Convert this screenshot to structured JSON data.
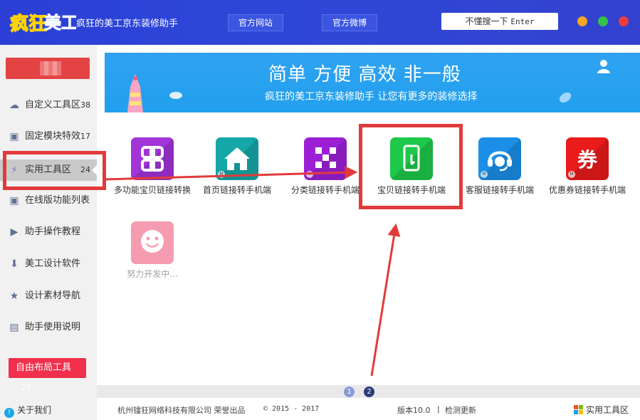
{
  "app": {
    "logo_text": "疯狂美工",
    "title": "疯狂的美工京东装修助手",
    "header_buttons": [
      "官方网站",
      "官方微博"
    ],
    "search_hint": "不懂搜一下",
    "search_key": "Enter"
  },
  "sidebar": {
    "items": [
      {
        "label": "自定义工具区",
        "count": "38"
      },
      {
        "label": "固定模块特效",
        "count": "17"
      },
      {
        "label": "实用工具区",
        "count": "24"
      },
      {
        "label": "在线版功能列表",
        "count": ""
      },
      {
        "label": "助手操作教程",
        "count": ""
      },
      {
        "label": "美工设计软件",
        "count": ""
      },
      {
        "label": "设计素材导航",
        "count": ""
      },
      {
        "label": "助手使用说明",
        "count": ""
      }
    ],
    "free_layout": {
      "label": "自由布局工具",
      "count": "21"
    },
    "about": "关于我们"
  },
  "banner": {
    "title": "简单 方便 高效 非一般",
    "subtitle": "疯狂的美工京东装修助手 让您有更多的装修选择"
  },
  "tools": [
    {
      "name": "多功能宝贝链接转换",
      "color": "#a234d8"
    },
    {
      "name": "首页链接转手机端",
      "color": "#15a7a7"
    },
    {
      "name": "分类链接转手机端",
      "color": "#9c1fd6"
    },
    {
      "name": "宝贝链接转手机端",
      "color": "#1ec84a"
    },
    {
      "name": "客服链接转手机端",
      "color": "#1b8fe8"
    },
    {
      "name": "优惠券链接转手机端",
      "color": "#e91b1b",
      "glyph": "券"
    },
    {
      "name": "努力开发中...",
      "color": "#f59cb0"
    }
  ],
  "pager": {
    "pages": [
      "1",
      "2"
    ]
  },
  "footer": {
    "company": "杭州镭狂网络科技有限公司 荣誉出品",
    "copyright": "© 2015 - 2017",
    "version": "版本10.0",
    "separator": "|",
    "check_update": "检测更新",
    "current_section": "实用工具区"
  }
}
